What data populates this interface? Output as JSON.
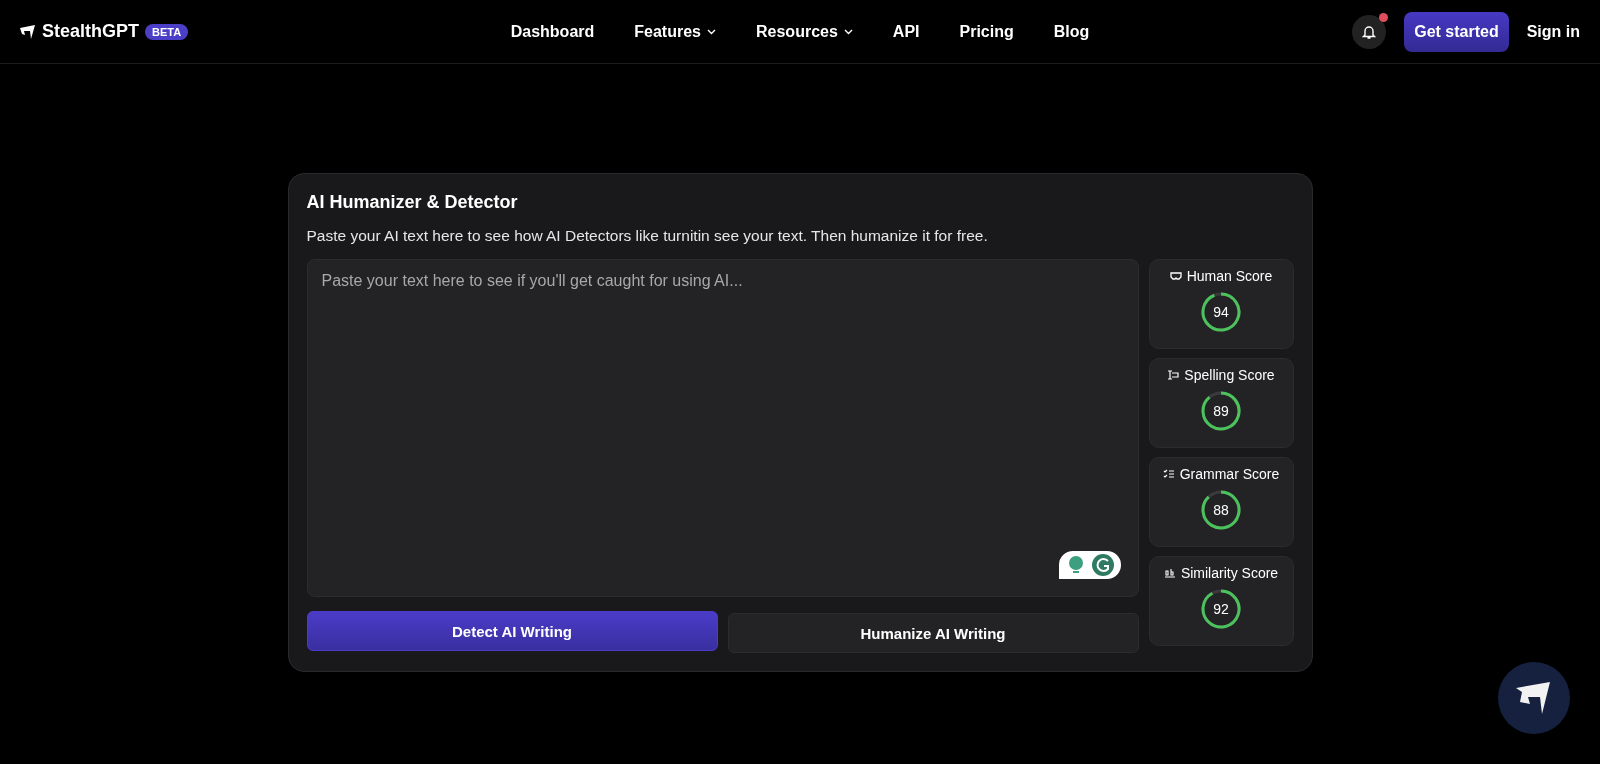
{
  "header": {
    "brand": "StealthGPT",
    "badge": "BETA",
    "nav": [
      {
        "label": "Dashboard",
        "dropdown": false
      },
      {
        "label": "Features",
        "dropdown": true
      },
      {
        "label": "Resources",
        "dropdown": true
      },
      {
        "label": "API",
        "dropdown": false
      },
      {
        "label": "Pricing",
        "dropdown": false
      },
      {
        "label": "Blog",
        "dropdown": false
      }
    ],
    "notification": true,
    "cta": "Get started",
    "sign_in": "Sign in"
  },
  "tool": {
    "title": "AI Humanizer & Detector",
    "description": "Paste your AI text here to see how AI Detectors like turnitin see your text. Then humanize it for free.",
    "input": {
      "placeholder": "Paste your text here to see if you'll get caught for using AI..."
    },
    "buttons": [
      {
        "label": "Detect AI Writing",
        "kind": "primary"
      },
      {
        "label": "Humanize AI Writing",
        "kind": "secondary"
      }
    ],
    "scores": [
      {
        "kind": "human",
        "label": "Human Score",
        "value": "94",
        "level": 0.94
      },
      {
        "kind": "spelling",
        "label": "Spelling Score",
        "value": "89",
        "level": 0.89
      },
      {
        "kind": "grammar",
        "label": "Grammar Score",
        "value": "88",
        "level": 0.88
      },
      {
        "kind": "similarity",
        "label": "Similarity Score",
        "value": "92",
        "level": 0.92
      }
    ]
  }
}
